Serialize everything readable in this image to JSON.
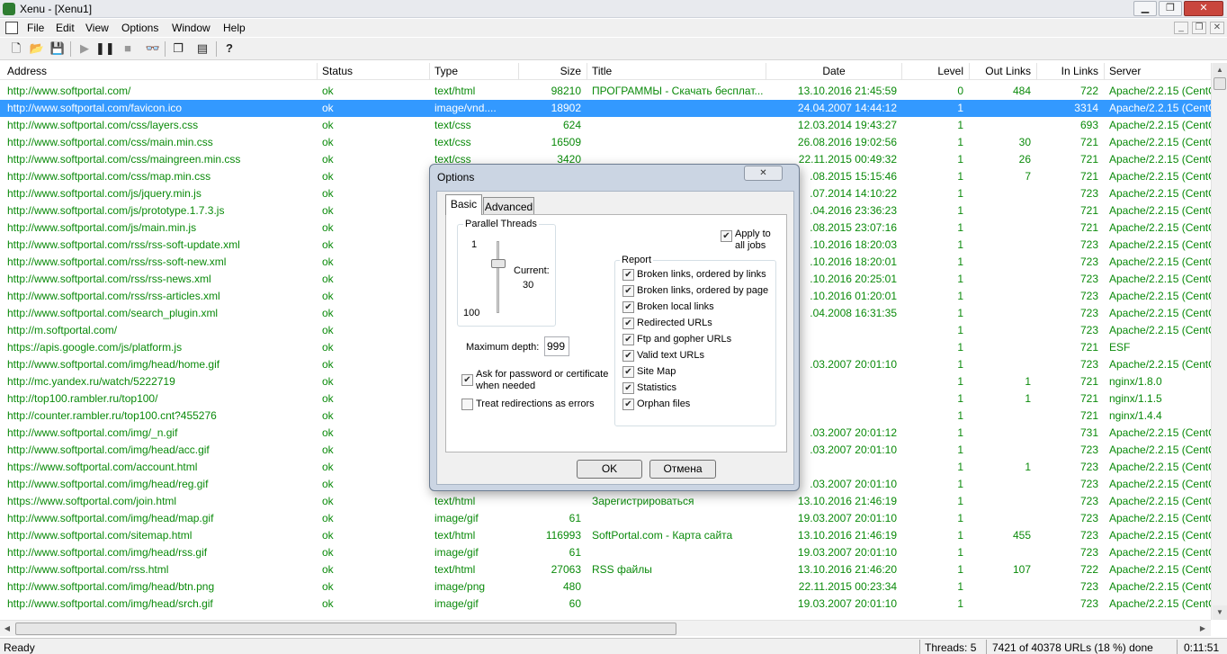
{
  "titlebar": {
    "title": "Xenu - [Xenu1]"
  },
  "menu": [
    "File",
    "Edit",
    "View",
    "Options",
    "Window",
    "Help"
  ],
  "columns": {
    "address": "Address",
    "status": "Status",
    "type": "Type",
    "size": "Size",
    "title": "Title",
    "date": "Date",
    "level": "Level",
    "outlinks": "Out Links",
    "inlinks": "In Links",
    "server": "Server"
  },
  "rows": [
    [
      "http://www.softportal.com/",
      "ok",
      "text/html",
      "98210",
      "ПРОГРАММЫ - Скачать бесплат...",
      "13.10.2016 21:45:59",
      "0",
      "484",
      "722",
      "Apache/2.2.15 (CentO"
    ],
    [
      "http://www.softportal.com/favicon.ico",
      "ok",
      "image/vnd....",
      "18902",
      "",
      "24.04.2007 14:44:12",
      "1",
      "",
      "3314",
      "Apache/2.2.15 (CentO"
    ],
    [
      "http://www.softportal.com/css/layers.css",
      "ok",
      "text/css",
      "624",
      "",
      "12.03.2014 19:43:27",
      "1",
      "",
      "693",
      "Apache/2.2.15 (CentO"
    ],
    [
      "http://www.softportal.com/css/main.min.css",
      "ok",
      "text/css",
      "16509",
      "",
      "26.08.2016 19:02:56",
      "1",
      "30",
      "721",
      "Apache/2.2.15 (CentO"
    ],
    [
      "http://www.softportal.com/css/maingreen.min.css",
      "ok",
      "text/css",
      "3420",
      "",
      "22.11.2015 00:49:32",
      "1",
      "26",
      "721",
      "Apache/2.2.15 (CentO"
    ],
    [
      "http://www.softportal.com/css/map.min.css",
      "ok",
      "",
      "",
      "",
      ".08.2015 15:15:46",
      "1",
      "7",
      "721",
      "Apache/2.2.15 (CentO"
    ],
    [
      "http://www.softportal.com/js/jquery.min.js",
      "ok",
      "",
      "",
      "",
      ".07.2014 14:10:22",
      "1",
      "",
      "723",
      "Apache/2.2.15 (CentO"
    ],
    [
      "http://www.softportal.com/js/prototype.1.7.3.js",
      "ok",
      "",
      "",
      "",
      ".04.2016 23:36:23",
      "1",
      "",
      "721",
      "Apache/2.2.15 (CentO"
    ],
    [
      "http://www.softportal.com/js/main.min.js",
      "ok",
      "",
      "",
      "",
      ".08.2015 23:07:16",
      "1",
      "",
      "721",
      "Apache/2.2.15 (CentO"
    ],
    [
      "http://www.softportal.com/rss/rss-soft-update.xml",
      "ok",
      "",
      "",
      "",
      ".10.2016 18:20:03",
      "1",
      "",
      "723",
      "Apache/2.2.15 (CentO"
    ],
    [
      "http://www.softportal.com/rss/rss-soft-new.xml",
      "ok",
      "",
      "",
      "",
      ".10.2016 18:20:01",
      "1",
      "",
      "723",
      "Apache/2.2.15 (CentO"
    ],
    [
      "http://www.softportal.com/rss/rss-news.xml",
      "ok",
      "",
      "",
      "",
      ".10.2016 20:25:01",
      "1",
      "",
      "723",
      "Apache/2.2.15 (CentO"
    ],
    [
      "http://www.softportal.com/rss/rss-articles.xml",
      "ok",
      "",
      "",
      "",
      ".10.2016 01:20:01",
      "1",
      "",
      "723",
      "Apache/2.2.15 (CentO"
    ],
    [
      "http://www.softportal.com/search_plugin.xml",
      "ok",
      "",
      "",
      "",
      ".04.2008 16:31:35",
      "1",
      "",
      "723",
      "Apache/2.2.15 (CentO"
    ],
    [
      "http://m.softportal.com/",
      "ok",
      "",
      "",
      "",
      "",
      "1",
      "",
      "723",
      "Apache/2.2.15 (CentO"
    ],
    [
      "https://apis.google.com/js/platform.js",
      "ok",
      "",
      "",
      "",
      "",
      "1",
      "",
      "721",
      "ESF"
    ],
    [
      "http://www.softportal.com/img/head/home.gif",
      "ok",
      "",
      "",
      "",
      ".03.2007 20:01:10",
      "1",
      "",
      "723",
      "Apache/2.2.15 (CentO"
    ],
    [
      "http://mc.yandex.ru/watch/5222719",
      "ok",
      "",
      "",
      "",
      "",
      "1",
      "1",
      "721",
      "nginx/1.8.0"
    ],
    [
      "http://top100.rambler.ru/top100/",
      "ok",
      "",
      "",
      "",
      "",
      "1",
      "1",
      "721",
      "nginx/1.1.5"
    ],
    [
      "http://counter.rambler.ru/top100.cnt?455276",
      "ok",
      "",
      "",
      "",
      "",
      "1",
      "",
      "721",
      "nginx/1.4.4"
    ],
    [
      "http://www.softportal.com/img/_n.gif",
      "ok",
      "",
      "",
      "",
      ".03.2007 20:01:12",
      "1",
      "",
      "731",
      "Apache/2.2.15 (CentO"
    ],
    [
      "http://www.softportal.com/img/head/acc.gif",
      "ok",
      "",
      "",
      "",
      ".03.2007 20:01:10",
      "1",
      "",
      "723",
      "Apache/2.2.15 (CentO"
    ],
    [
      "https://www.softportal.com/account.html",
      "ok",
      "",
      "",
      "",
      "",
      "1",
      "1",
      "723",
      "Apache/2.2.15 (CentO"
    ],
    [
      "http://www.softportal.com/img/head/reg.gif",
      "ok",
      "",
      "",
      "",
      ".03.2007 20:01:10",
      "1",
      "",
      "723",
      "Apache/2.2.15 (CentO"
    ],
    [
      "https://www.softportal.com/join.html",
      "ok",
      "text/html",
      "",
      "Зарегистрироваться",
      "13.10.2016 21:46:19",
      "1",
      "",
      "723",
      "Apache/2.2.15 (CentO"
    ],
    [
      "http://www.softportal.com/img/head/map.gif",
      "ok",
      "image/gif",
      "61",
      "",
      "19.03.2007 20:01:10",
      "1",
      "",
      "723",
      "Apache/2.2.15 (CentO"
    ],
    [
      "http://www.softportal.com/sitemap.html",
      "ok",
      "text/html",
      "116993",
      "SoftPortal.com - Карта сайта",
      "13.10.2016 21:46:19",
      "1",
      "455",
      "723",
      "Apache/2.2.15 (CentO"
    ],
    [
      "http://www.softportal.com/img/head/rss.gif",
      "ok",
      "image/gif",
      "61",
      "",
      "19.03.2007 20:01:10",
      "1",
      "",
      "723",
      "Apache/2.2.15 (CentO"
    ],
    [
      "http://www.softportal.com/rss.html",
      "ok",
      "text/html",
      "27063",
      "RSS файлы",
      "13.10.2016 21:46:20",
      "1",
      "107",
      "722",
      "Apache/2.2.15 (CentO"
    ],
    [
      "http://www.softportal.com/img/head/btn.png",
      "ok",
      "image/png",
      "480",
      "",
      "22.11.2015 00:23:34",
      "1",
      "",
      "723",
      "Apache/2.2.15 (CentO"
    ],
    [
      "http://www.softportal.com/img/head/srch.gif",
      "ok",
      "image/gif",
      "60",
      "",
      "19.03.2007 20:01:10",
      "1",
      "",
      "723",
      "Apache/2.2.15 (CentO"
    ]
  ],
  "selected_row": 1,
  "dialog": {
    "title": "Options",
    "close": "✕",
    "tab_basic": "Basic",
    "tab_advanced": "Advanced",
    "threads_group": "Parallel Threads",
    "threads_min": "1",
    "threads_max": "100",
    "current_label": "Current:",
    "current_value": "30",
    "threads_fraction": 0.29,
    "apply_all": "Apply to all jobs",
    "max_depth_label": "Maximum depth:",
    "max_depth": "999",
    "ask_password": "Ask for password or certificate when needed",
    "treat_redirect": "Treat redirections as errors",
    "report_group": "Report",
    "report_items": [
      "Broken links, ordered by links",
      "Broken links, ordered by page",
      "Broken local links",
      "Redirected URLs",
      "Ftp and gopher URLs",
      "Valid text URLs",
      "Site Map",
      "Statistics",
      "Orphan files"
    ],
    "ok": "OK",
    "cancel": "Отмена"
  },
  "status": {
    "ready": "Ready",
    "threads": "Threads: 5",
    "progress": "7421 of 40378 URLs (18 %) done",
    "time": "0:11:51"
  },
  "colors": {
    "row_text": "#0a8a0a",
    "selection": "#3399ff"
  }
}
